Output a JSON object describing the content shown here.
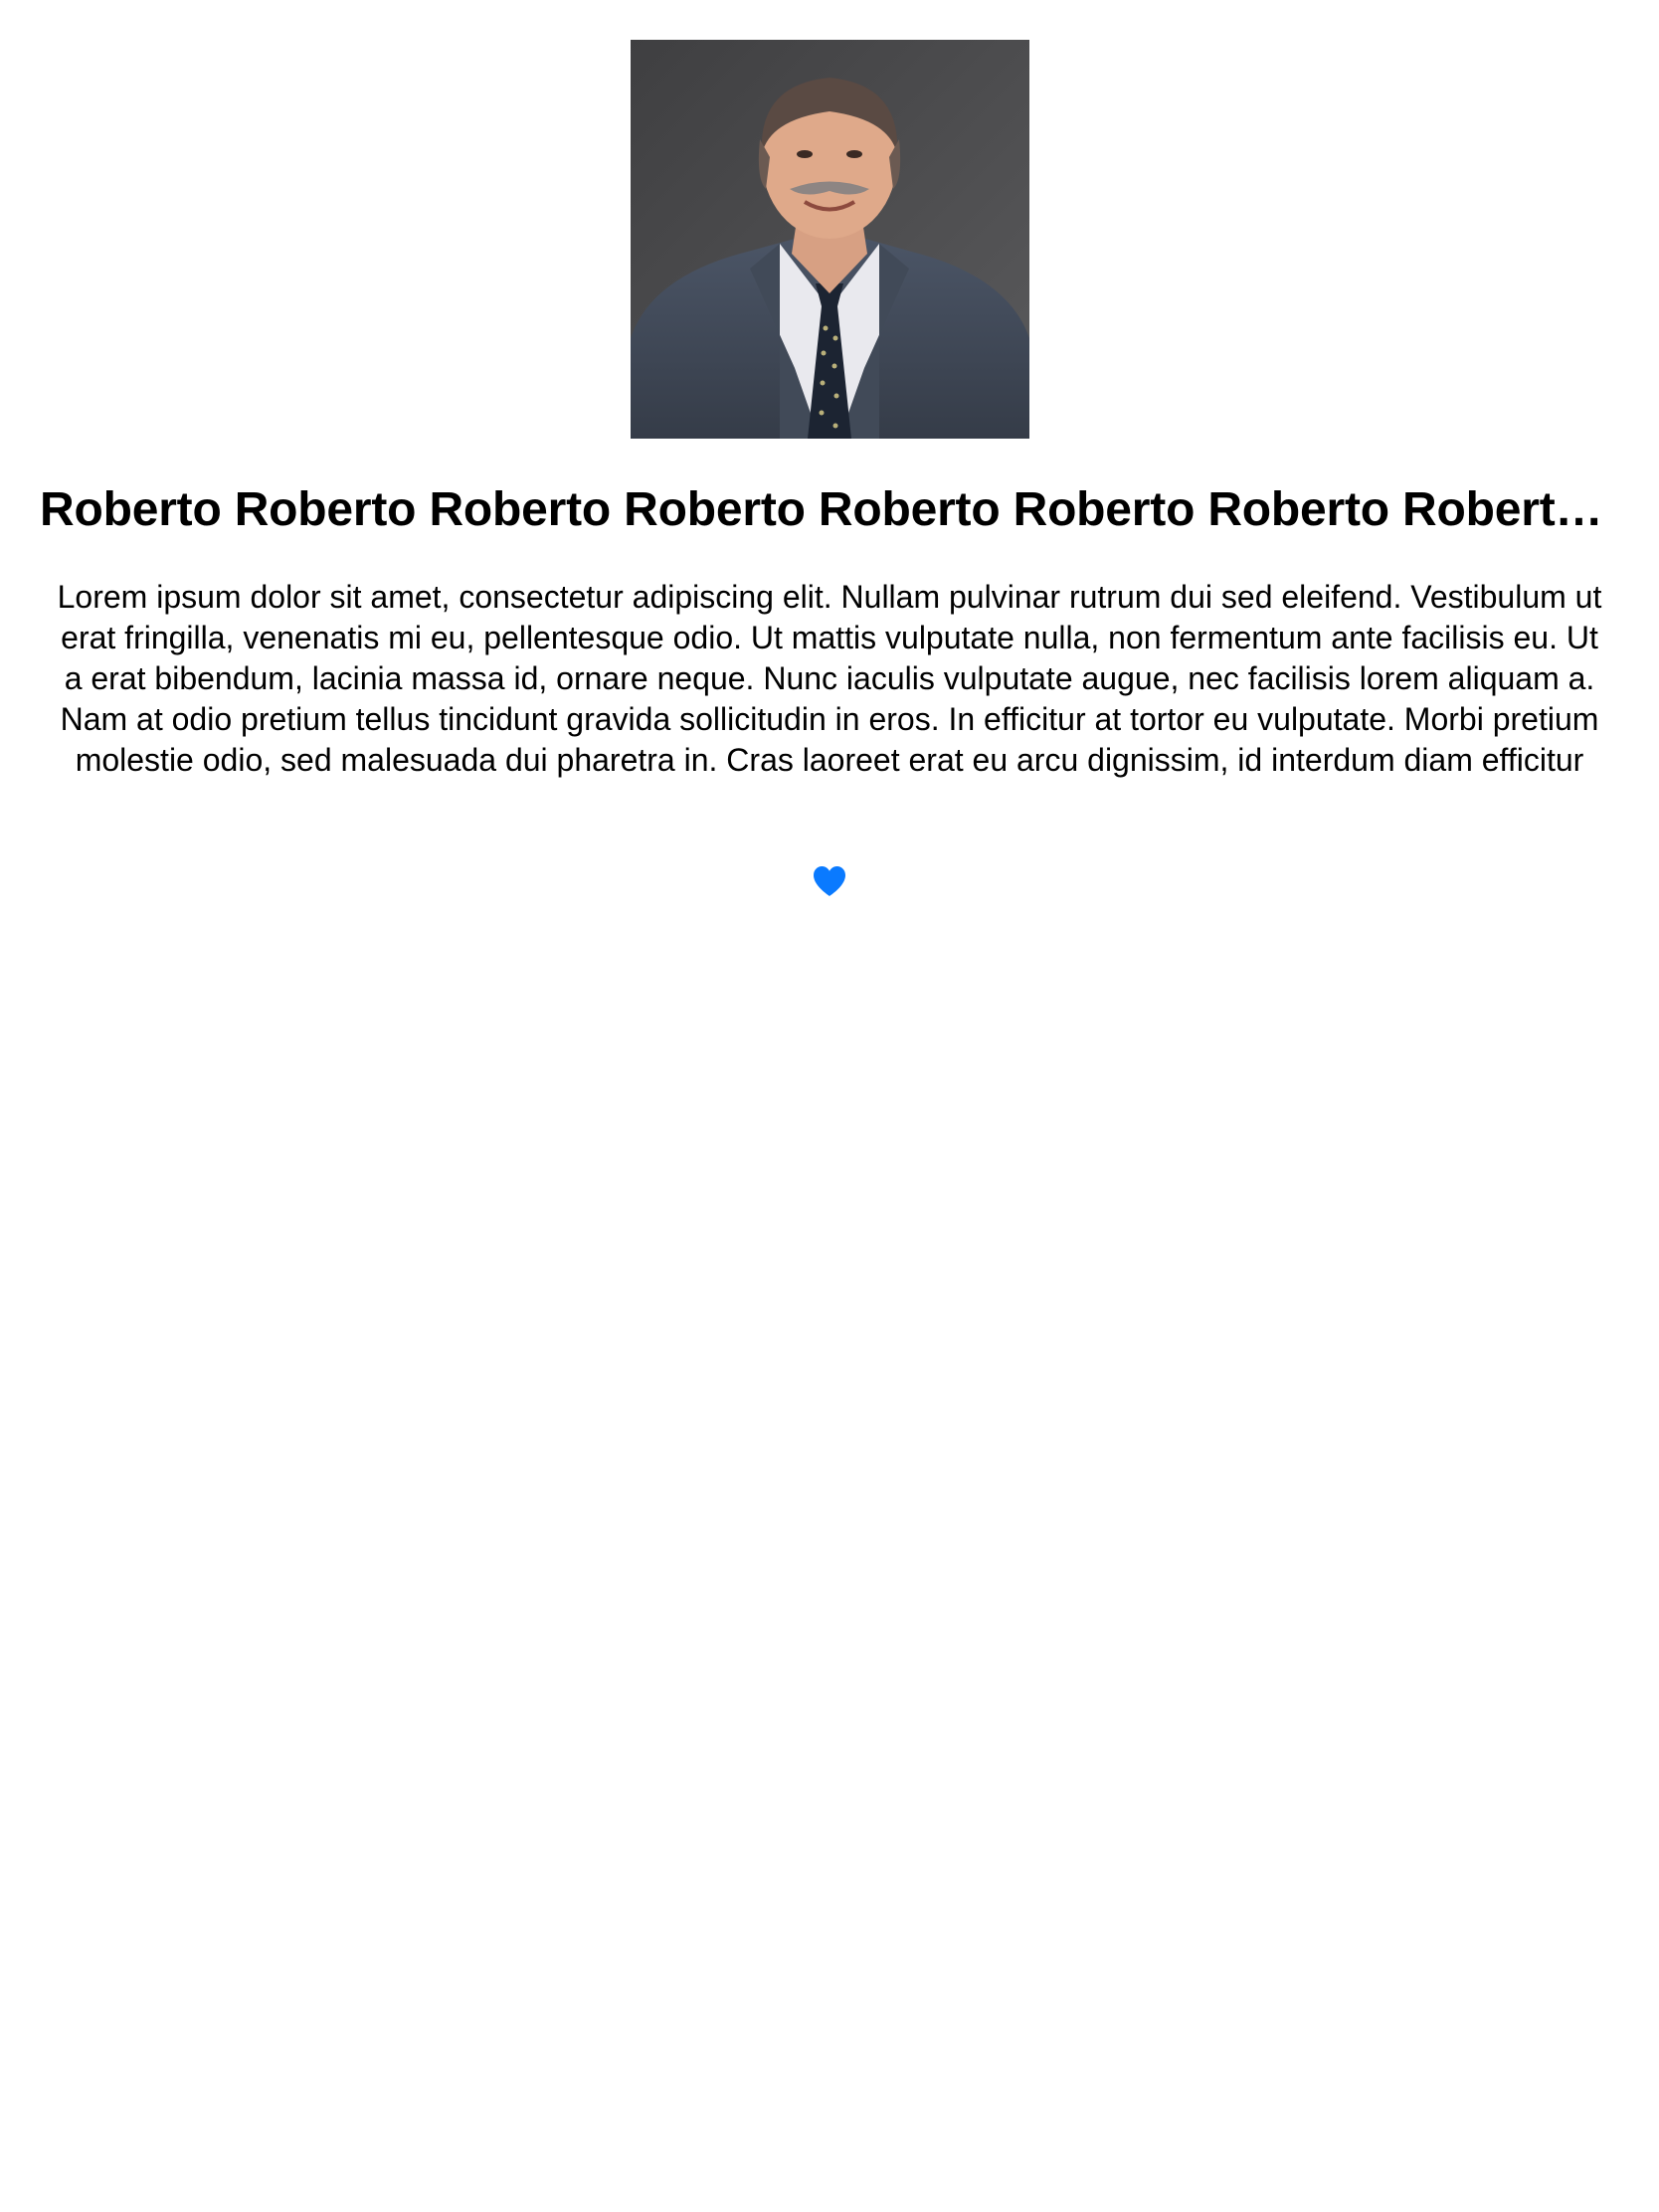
{
  "profile": {
    "name": "Roberto Roberto Roberto Roberto Roberto Roberto Roberto Roberto Roberto Roberto",
    "bio": "Lorem ipsum dolor sit amet, consectetur adipiscing elit. Nullam pulvinar rutrum dui sed eleifend. Vestibulum ut erat fringilla, venenatis mi eu, pellentesque odio. Ut mattis vulputate nulla, non fermentum ante facilisis eu. Ut a erat bibendum, lacinia massa id, ornare neque. Nunc iaculis vulputate augue, nec facilisis lorem aliquam a. Nam at odio pretium tellus tincidunt gravida sollicitudin in eros. In efficitur at tortor eu vulputate. Morbi pretium molestie odio, sed malesuada dui pharetra in. Cras laoreet erat eu arcu dignissim, id interdum diam efficitur",
    "photo_icon": "person-portrait",
    "favorite_icon": "heart-icon",
    "favorited": true
  },
  "colors": {
    "accent": "#0a7aff",
    "background": "#ffffff",
    "text": "#000000"
  }
}
